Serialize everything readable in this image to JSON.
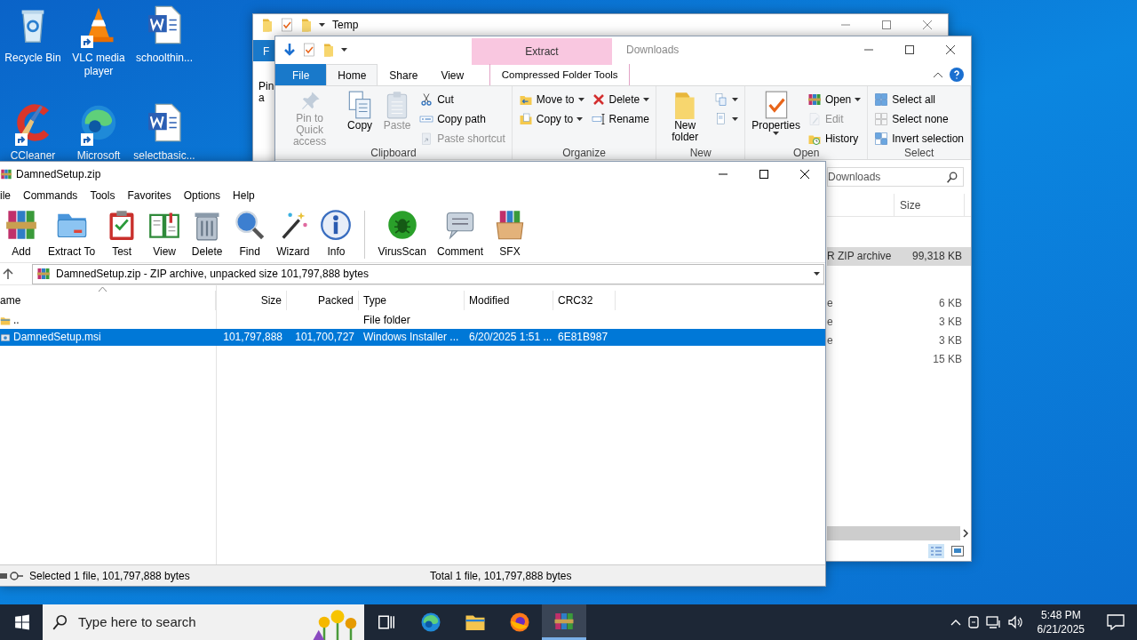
{
  "desktop_icons": [
    {
      "label": "Recycle Bin",
      "kind": "trash",
      "shortcut": false
    },
    {
      "label": "VLC media player",
      "kind": "cone",
      "shortcut": true
    },
    {
      "label": "schoolthin...",
      "kind": "doc",
      "shortcut": false
    },
    {
      "label": "CCleaner",
      "kind": "brush",
      "shortcut": true
    },
    {
      "label": "Microsoft",
      "kind": "browser",
      "shortcut": true
    },
    {
      "label": "selectbasic...",
      "kind": "doc",
      "shortcut": false
    }
  ],
  "back_window": {
    "title": "Temp",
    "file_tab": "F",
    "ribbon_text": [
      "Pin",
      "a"
    ]
  },
  "explorer": {
    "title": "Downloads",
    "context_header": "Extract",
    "tabs": [
      {
        "label": "File",
        "kind": "file",
        "selected": false
      },
      {
        "label": "Home",
        "kind": "plain",
        "selected": true
      },
      {
        "label": "Share",
        "kind": "plain",
        "selected": false
      },
      {
        "label": "View",
        "kind": "plain",
        "selected": false
      },
      {
        "label": "Compressed Folder Tools",
        "kind": "context",
        "selected": false
      }
    ],
    "groups": [
      {
        "label": "Clipboard",
        "items": [
          {
            "kind": "pin",
            "label": "Pin to Quick access",
            "disabled": true,
            "dropdown": false
          },
          {
            "kind": "copy",
            "label": "Copy",
            "disabled": false,
            "dropdown": false
          },
          {
            "kind": "paste",
            "label": "Paste",
            "disabled": true,
            "dropdown": false
          },
          {
            "kind": "column",
            "items": [
              {
                "kind": "cut",
                "label": "Cut",
                "disabled": false,
                "dropdown": false
              },
              {
                "kind": "copypath",
                "label": "Copy path",
                "disabled": false,
                "dropdown": false
              },
              {
                "kind": "pasteshortcut",
                "label": "Paste shortcut",
                "disabled": true,
                "dropdown": false
              }
            ]
          }
        ]
      },
      {
        "label": "Organize",
        "items": [
          {
            "kind": "column",
            "items": [
              {
                "kind": "moveto",
                "label": "Move to",
                "disabled": false,
                "dropdown": true
              },
              {
                "kind": "copyto",
                "label": "Copy to",
                "disabled": false,
                "dropdown": true
              }
            ]
          },
          {
            "kind": "column",
            "items": [
              {
                "kind": "xdel",
                "label": "Delete",
                "disabled": false,
                "dropdown": true
              },
              {
                "kind": "rename",
                "label": "Rename",
                "disabled": false,
                "dropdown": false
              }
            ]
          }
        ]
      },
      {
        "label": "New",
        "items": [
          {
            "kind": "newfolder",
            "label": "New folder",
            "disabled": false,
            "dropdown": false
          },
          {
            "kind": "column",
            "items": [
              {
                "kind": "newitem",
                "disabled": false,
                "dropdown": true
              },
              {
                "kind": "easyaccess",
                "disabled": false,
                "dropdown": true
              }
            ]
          }
        ]
      },
      {
        "label": "Open",
        "items": [
          {
            "kind": "properties",
            "label": "Properties",
            "disabled": false,
            "dropdown": true
          },
          {
            "kind": "column",
            "items": [
              {
                "kind": "archive",
                "label": "Open",
                "disabled": false,
                "dropdown": true
              },
              {
                "kind": "edit",
                "label": "Edit",
                "disabled": true,
                "dropdown": false
              },
              {
                "kind": "history",
                "label": "History",
                "disabled": false,
                "dropdown": false
              }
            ]
          }
        ]
      },
      {
        "label": "Select",
        "items": [
          {
            "kind": "column",
            "items": [
              {
                "kind": "selectall",
                "label": "Select all",
                "disabled": false,
                "dropdown": false
              },
              {
                "kind": "selectnone",
                "label": "Select none",
                "disabled": false,
                "dropdown": false
              },
              {
                "kind": "invert",
                "label": "Invert selection",
                "disabled": false,
                "dropdown": false
              }
            ]
          }
        ]
      }
    ],
    "search": {
      "value": "Downloads"
    },
    "columns": [
      "Size"
    ],
    "rows": [
      {
        "type": "R ZIP archive",
        "size": "99,318 KB",
        "selected": true
      },
      {
        "type": "e",
        "size": "6 KB",
        "selected": false
      },
      {
        "type": "e",
        "size": "3 KB",
        "selected": false
      },
      {
        "type": "e",
        "size": "3 KB",
        "selected": false
      },
      {
        "size": "15 KB",
        "selected": false
      }
    ]
  },
  "winrar": {
    "title": "DamnedSetup.zip",
    "menu": [
      "ile",
      "Commands",
      "Tools",
      "Favorites",
      "Options",
      "Help"
    ],
    "toolbar": [
      {
        "kind": "add",
        "label": "Add"
      },
      {
        "kind": "extract",
        "label": "Extract To"
      },
      {
        "kind": "test",
        "label": "Test"
      },
      {
        "kind": "view",
        "label": "View"
      },
      {
        "kind": "rardelete",
        "label": "Delete"
      },
      {
        "kind": "find",
        "label": "Find"
      },
      {
        "kind": "wizard",
        "label": "Wizard"
      },
      {
        "kind": "info",
        "label": "Info"
      },
      {
        "kind": "separator"
      },
      {
        "kind": "virusscan",
        "label": "VirusScan"
      },
      {
        "kind": "comment",
        "label": "Comment"
      },
      {
        "kind": "sfx",
        "label": "SFX"
      }
    ],
    "address": "DamnedSetup.zip - ZIP archive, unpacked size 101,797,888 bytes",
    "columns": [
      "ame",
      "Size",
      "Packed",
      "Type",
      "Modified",
      "CRC32"
    ],
    "rows": [
      {
        "kind": "folder",
        "name": "..",
        "type": "File folder",
        "selected": false
      },
      {
        "kind": "file",
        "name": "DamnedSetup.msi",
        "size": "101,797,888",
        "packed": "101,700,727",
        "type": "Windows Installer ...",
        "modified": "6/20/2025 1:51 ...",
        "crc": "6E81B987",
        "selected": true
      }
    ],
    "status_left": "Selected 1 file, 101,797,888 bytes",
    "status_right": "Total 1 file, 101,797,888 bytes"
  },
  "taskbar": {
    "search": {
      "placeholder": "Type here to search"
    },
    "apps": [
      {
        "kind": "taskview",
        "active": false
      },
      {
        "kind": "browser",
        "active": false
      },
      {
        "kind": "folder",
        "active": false
      },
      {
        "kind": "firefox",
        "active": false
      },
      {
        "kind": "archive",
        "active": true
      }
    ],
    "time": "5:48 PM",
    "date": "6/21/2025"
  }
}
